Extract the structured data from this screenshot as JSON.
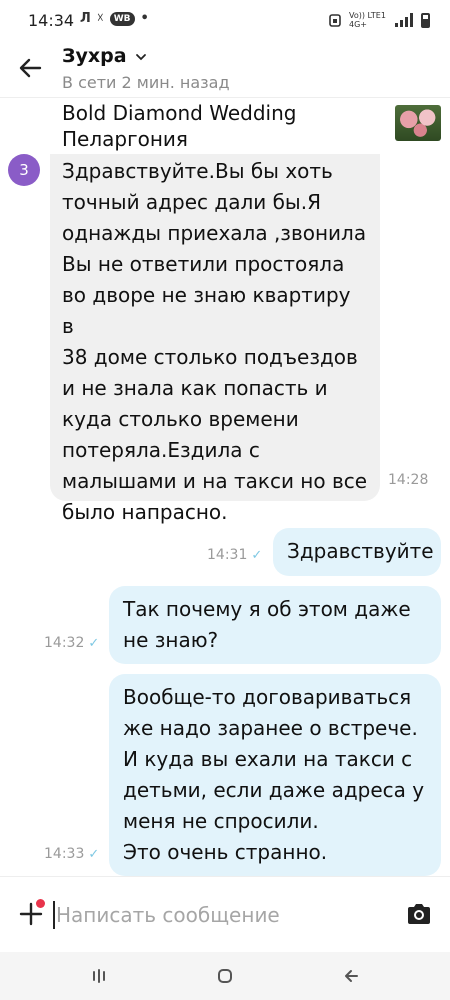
{
  "status_bar": {
    "time": "14:34",
    "left_icons": [
      "Л",
      "☓",
      "WB",
      "•"
    ],
    "network": "Vo)) LTE1 4G+"
  },
  "header": {
    "contact_name": "Зухра",
    "contact_status": "В сети 2 мин. назад"
  },
  "product": {
    "title_line1": "Bold Diamond Wedding",
    "title_line2": "Пеларгония"
  },
  "unread_count": "3",
  "messages": [
    {
      "direction": "incoming",
      "lines": [
        "Здравствуйте.Вы бы хоть",
        "точный адрес дали бы.Я",
        "однажды приехала ,звонила",
        "Вы не ответили простояла",
        "во дворе не знаю квартиру в",
        "38 доме столько подъездов",
        "и не знала как попасть и",
        "куда столько времени",
        "потеряла.Ездила с",
        "малышами и на такси но все",
        "было напрасно."
      ],
      "time": "14:28"
    },
    {
      "direction": "outgoing",
      "lines": [
        "Здравствуйте"
      ],
      "time": "14:31"
    },
    {
      "direction": "outgoing",
      "lines": [
        "Так почему я об этом даже",
        "не знаю?"
      ],
      "time": "14:32"
    },
    {
      "direction": "outgoing",
      "lines": [
        "Вообще-то договариваться",
        "же надо заранее о встрече.",
        "И куда вы ехали на такси с",
        "детьми, если даже адреса у",
        "меня не спросили.",
        "Это очень странно."
      ],
      "time": "14:33"
    }
  ],
  "composer": {
    "placeholder": "Написать сообщение"
  },
  "colors": {
    "incoming_bubble": "#f0f0f0",
    "outgoing_bubble": "#e2f3fb",
    "unread_badge": "#8a5cc7",
    "read_tick": "#7ec8e3",
    "notification_dot": "#e8344b"
  },
  "icons": {
    "back": "arrow-left-icon",
    "chevron": "chevron-down-icon",
    "attach": "plus-icon",
    "camera": "camera-icon",
    "nav_recents": "recents-icon",
    "nav_home": "home-icon",
    "nav_back": "back-icon"
  }
}
